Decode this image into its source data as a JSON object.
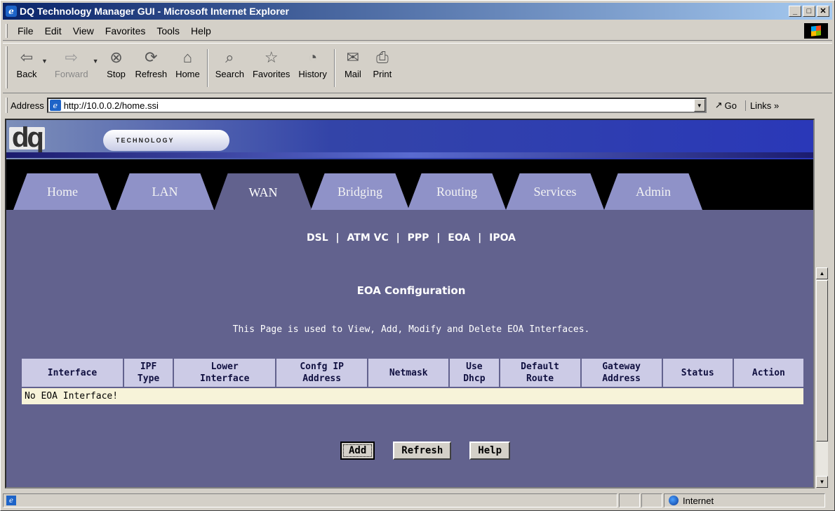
{
  "window": {
    "title": "DQ Technology Manager GUI - Microsoft Internet Explorer"
  },
  "menu": {
    "items": [
      "File",
      "Edit",
      "View",
      "Favorites",
      "Tools",
      "Help"
    ]
  },
  "toolbar": {
    "back": "Back",
    "forward": "Forward",
    "stop": "Stop",
    "refresh": "Refresh",
    "home": "Home",
    "search": "Search",
    "favorites": "Favorites",
    "history": "History",
    "mail": "Mail",
    "print": "Print"
  },
  "address": {
    "label": "Address",
    "url": "http://10.0.0.2/home.ssi",
    "go": "Go",
    "links": "Links"
  },
  "banner": {
    "logo": "dq",
    "tagline": "TECHNOLOGY"
  },
  "tabs": [
    "Home",
    "LAN",
    "WAN",
    "Bridging",
    "Routing",
    "Services",
    "Admin"
  ],
  "active_tab": "WAN",
  "subnav": [
    "DSL",
    "ATM VC",
    "PPP",
    "EOA",
    "IPOA"
  ],
  "subnav_sep": "|",
  "page": {
    "title": "EOA Configuration",
    "description": "This Page is used to View, Add, Modify and Delete EOA Interfaces."
  },
  "table": {
    "headers": [
      [
        "Interface"
      ],
      [
        "IPF",
        "Type"
      ],
      [
        "Lower",
        "Interface"
      ],
      [
        "Confg IP",
        "Address"
      ],
      [
        "Netmask"
      ],
      [
        "Use",
        "Dhcp"
      ],
      [
        "Default",
        "Route"
      ],
      [
        "Gateway",
        "Address"
      ],
      [
        "Status"
      ],
      [
        "Action"
      ]
    ],
    "empty_message": "No EOA Interface!"
  },
  "buttons": {
    "add": "Add",
    "refresh": "Refresh",
    "help": "Help"
  },
  "status": {
    "zone": "Internet"
  },
  "colors": {
    "content_bg": "#62628e",
    "tab_bg": "#8f92c8",
    "header_bg": "#cccbe6",
    "row_bg": "#f7f3d9"
  }
}
